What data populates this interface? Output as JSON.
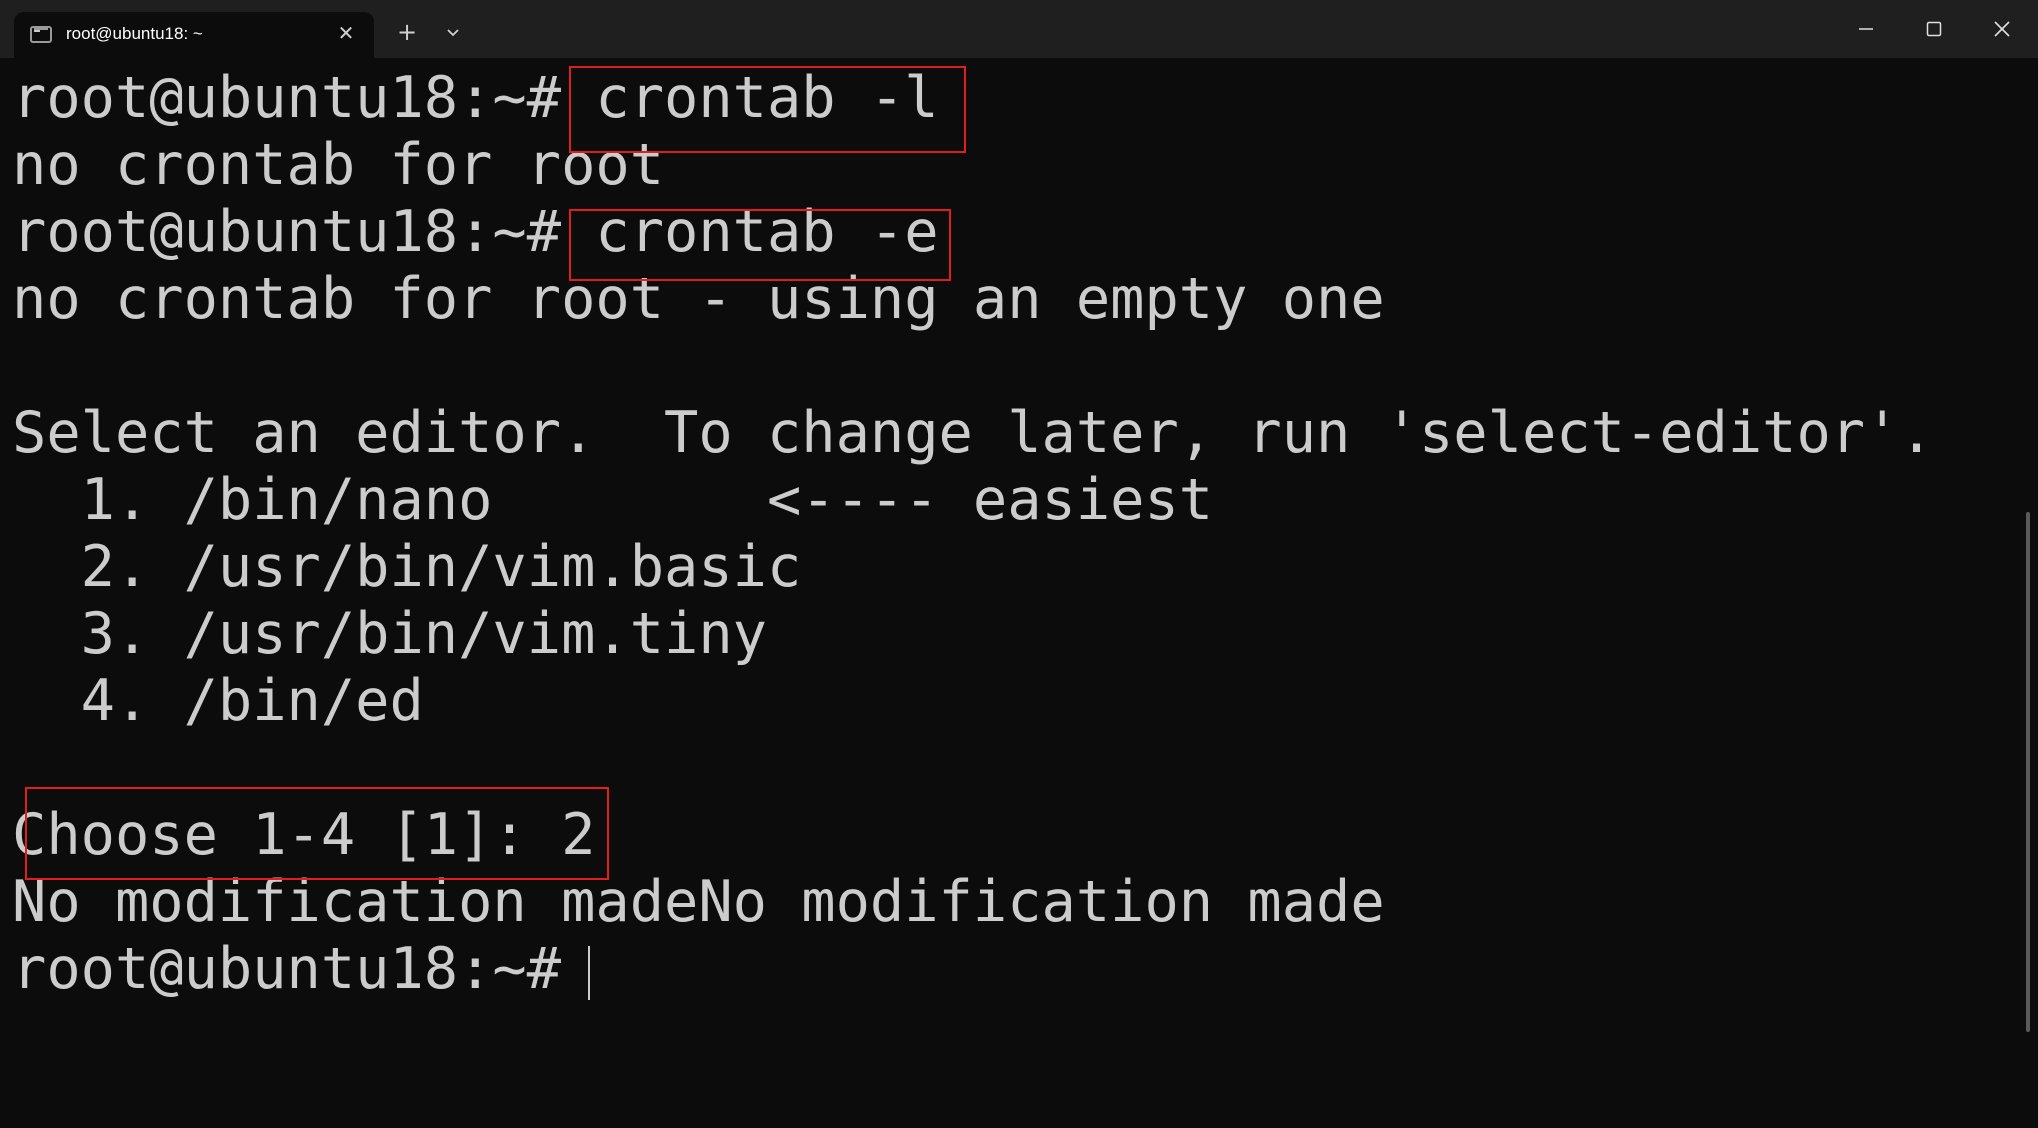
{
  "tab": {
    "title": "root@ubuntu18: ~",
    "icon": "terminal-icon",
    "close_glyph": "✕",
    "new_tab_glyph": "+"
  },
  "window_controls": {
    "minimize": "minimize-icon",
    "maximize": "maximize-icon",
    "close": "close-icon"
  },
  "terminal": {
    "lines": [
      "root@ubuntu18:~# crontab -l",
      "no crontab for root",
      "root@ubuntu18:~# crontab -e",
      "no crontab for root - using an empty one",
      "",
      "Select an editor.  To change later, run 'select-editor'.",
      "  1. /bin/nano        <---- easiest",
      "  2. /usr/bin/vim.basic",
      "  3. /usr/bin/vim.tiny",
      "  4. /bin/ed",
      "",
      "Choose 1-4 [1]: 2",
      "No modification madeNo modification made",
      "root@ubuntu18:~# "
    ]
  },
  "colors": {
    "background": "#0c0c0c",
    "titlebar": "#1f1f1f",
    "text": "#cccccc",
    "highlight_border": "#e01e1e"
  }
}
